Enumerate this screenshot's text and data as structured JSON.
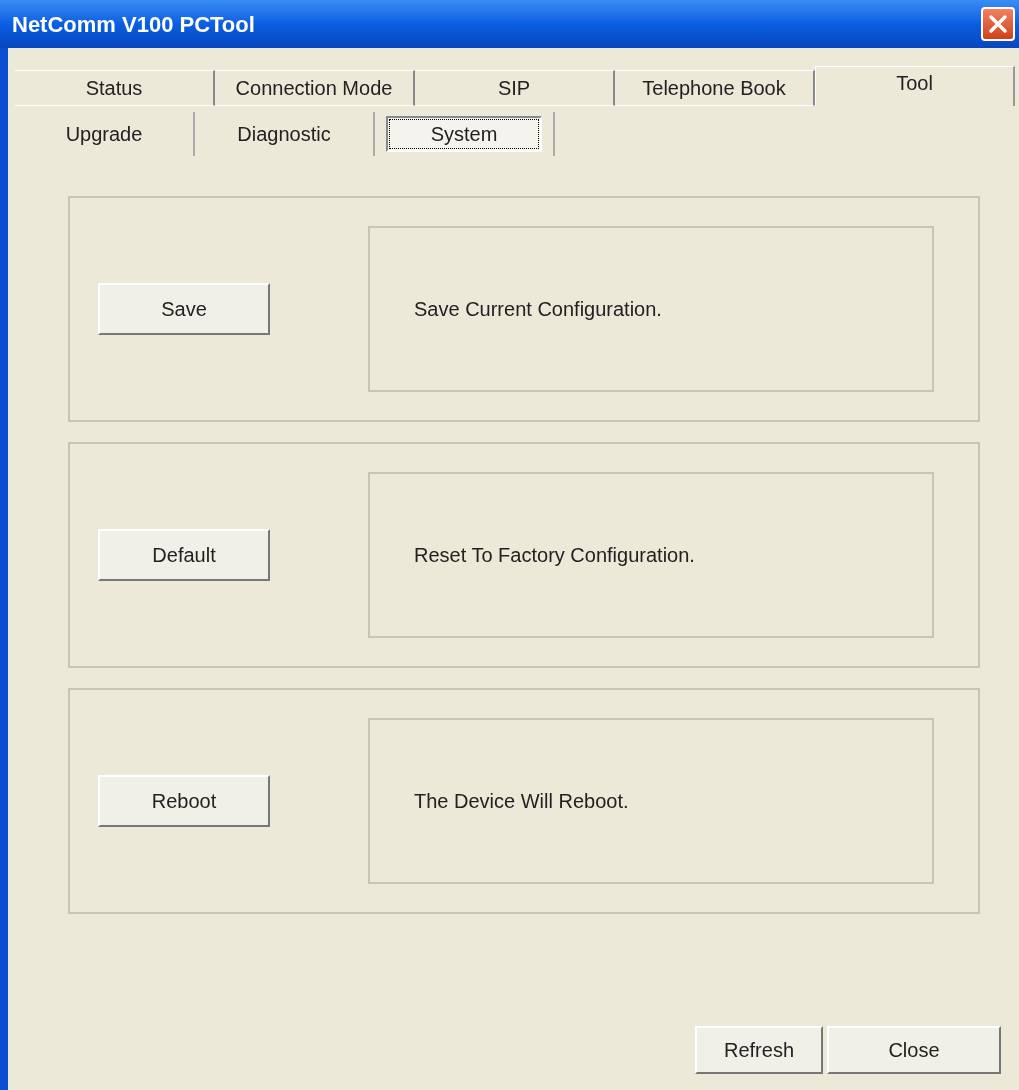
{
  "window": {
    "title": "NetComm V100 PCTool"
  },
  "tabs": [
    {
      "label": "Status",
      "selected": false
    },
    {
      "label": "Connection Mode",
      "selected": false
    },
    {
      "label": "SIP",
      "selected": false
    },
    {
      "label": "Telephone Book",
      "selected": false
    },
    {
      "label": "Tool",
      "selected": true
    }
  ],
  "subtabs": [
    {
      "label": "Upgrade",
      "selected": false
    },
    {
      "label": "Diagnostic",
      "selected": false
    },
    {
      "label": "System",
      "selected": true
    }
  ],
  "actions": [
    {
      "button": "Save",
      "description": "Save Current Configuration."
    },
    {
      "button": "Default",
      "description": "Reset To Factory Configuration."
    },
    {
      "button": "Reboot",
      "description": "The Device Will Reboot."
    }
  ],
  "buttons": [
    "Refresh",
    "Close"
  ]
}
